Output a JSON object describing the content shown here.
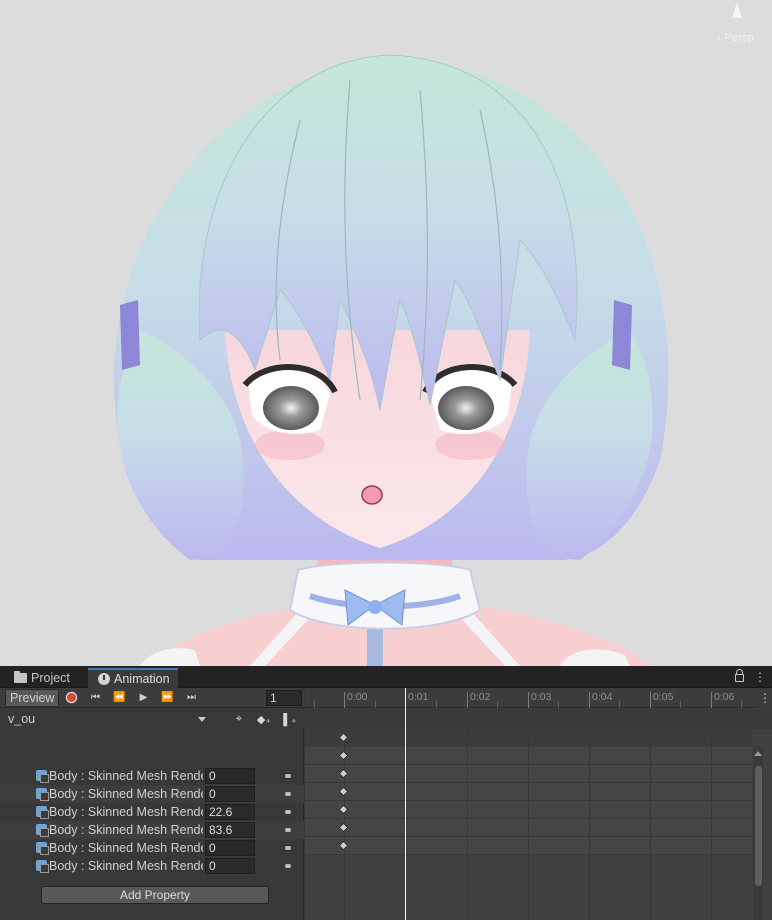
{
  "scene": {
    "gizmo_label": "‹ Persp"
  },
  "tabs": [
    {
      "label": "Project",
      "icon": "folder-icon"
    },
    {
      "label": "Animation",
      "icon": "clock-icon"
    }
  ],
  "tab_menu_glyph": "⋮",
  "toolbar": {
    "preview_label": "Preview",
    "frame_value": "1",
    "first_glyph": "⏮",
    "prev_glyph": "⏪",
    "play_glyph": "▶",
    "next_glyph": "⏩",
    "last_glyph": "⏭"
  },
  "clip": {
    "selected": "v_ou"
  },
  "tools": {
    "keyframe_glyph": "◆₊",
    "event_glyph": "▌₊",
    "filter_glyph": "⌖"
  },
  "properties": [
    {
      "name": "Body : Skinned Mesh Renderer.blendShape",
      "value": "0"
    },
    {
      "name": "Body : Skinned Mesh Renderer.blendShape",
      "value": "0"
    },
    {
      "name": "Body : Skinned Mesh Renderer.blendShape",
      "value": "22.6"
    },
    {
      "name": "Body : Skinned Mesh Renderer.blendShape",
      "value": "83.6"
    },
    {
      "name": "Body : Skinned Mesh Renderer.blendShape",
      "value": "0"
    },
    {
      "name": "Body : Skinned Mesh Renderer.blendShape",
      "value": "0"
    }
  ],
  "add_property_label": "Add Property",
  "timeline": {
    "labels": [
      "0:00",
      "0:01",
      "0:02",
      "0:03",
      "0:04",
      "0:05",
      "0:06"
    ],
    "playhead_time": "0:01",
    "keyframe_time": "0:00"
  }
}
